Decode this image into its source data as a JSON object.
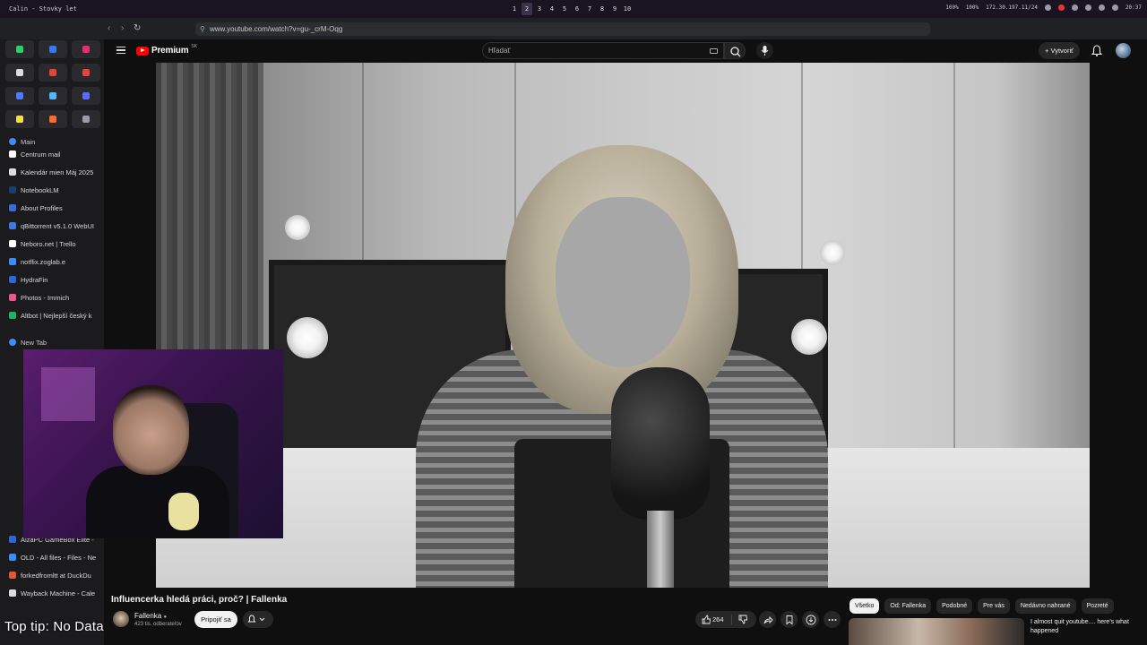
{
  "os": {
    "window_title": "Calin - Stovky let",
    "workspaces": [
      "1",
      "2",
      "3",
      "4",
      "5",
      "6",
      "7",
      "8",
      "9",
      "10"
    ],
    "active_workspace": "2",
    "status": {
      "cpu": "100%",
      "mem": "100%",
      "ip": "172.30.197.11/24",
      "time": "20:37"
    }
  },
  "browser": {
    "url": "www.youtube.com/watch?v=gu-_crM-Oqg"
  },
  "sidebar": {
    "pinned_icons": [
      {
        "name": "whatsapp-icon",
        "color": "#25d366"
      },
      {
        "name": "messenger-icon",
        "color": "#2f7bf5"
      },
      {
        "name": "instagram-icon",
        "color": "#e1306c"
      },
      {
        "name": "x-icon",
        "color": "#dddddd"
      },
      {
        "name": "gmail-icon",
        "color": "#ea4335"
      },
      {
        "name": "gmail-icon-2",
        "color": "#ea4335"
      },
      {
        "name": "chat-icon",
        "color": "#4a7cff"
      },
      {
        "name": "drop-icon",
        "color": "#4fb8ff"
      },
      {
        "name": "app-icon",
        "color": "#5a6cff"
      },
      {
        "name": "notes-icon",
        "color": "#f4e04d"
      },
      {
        "name": "fox-icon",
        "color": "#ff6a2b"
      },
      {
        "name": "settings-icon",
        "color": "#9a9aa8"
      }
    ],
    "tabs": [
      {
        "label": "Main",
        "color": "#3b8ef5",
        "group": true
      },
      {
        "label": "Centrum mail",
        "color": "#ffffff"
      },
      {
        "label": "Kalendár mien Máj 2025",
        "color": "#dddddd"
      },
      {
        "label": "NotebookLM",
        "color": "#1c3b6e"
      },
      {
        "label": "About Profiles",
        "color": "#3a6bd8"
      },
      {
        "label": "qBittorrent v5.1.0 WebUI",
        "color": "#3c7be0"
      },
      {
        "label": "Neboro.net | Trello",
        "color": "#ffffff"
      },
      {
        "label": "notflix.zoglab.e",
        "color": "#3b8ef5"
      },
      {
        "label": "HydraFin",
        "color": "#2f66d6"
      },
      {
        "label": "Photos - Immich",
        "color": "#e85a8a"
      },
      {
        "label": "Altbot | Nejlepší český k",
        "color": "#1fb36a"
      },
      {
        "label": "New Tab",
        "color": "#3b8ef5",
        "group": true
      },
      {
        "label": "AlzaPC GameBox Elite - ",
        "color": "#2f66d6"
      },
      {
        "label": "OLD - All files - Files - Ne",
        "color": "#3b8ef5"
      },
      {
        "label": "forkedfromltt at DuckDu",
        "color": "#de5833"
      },
      {
        "label": "Wayback Machine - Cale",
        "color": "#dddddd"
      }
    ],
    "tip": "Top tip: No Data"
  },
  "youtube": {
    "logo_text": "Premium",
    "logo_region": "SK",
    "search_placeholder": "Hľadať",
    "create_label": "Vytvoriť",
    "video_title": "Influencerka hledá práci, proč? | Fallenka",
    "channel_name": "Fallenka",
    "channel_subs": "423 tis. odberateľov",
    "subscribe_label": "Pripojiť sa",
    "likes": "264",
    "chips": [
      "Všetko",
      "Od: Fallenka",
      "Podobné",
      "Pre vás",
      "Nedávno nahrané",
      "Pozreté"
    ],
    "active_chip": "Všetko",
    "related_title": "I almost quit youtube.... here's what happened"
  }
}
